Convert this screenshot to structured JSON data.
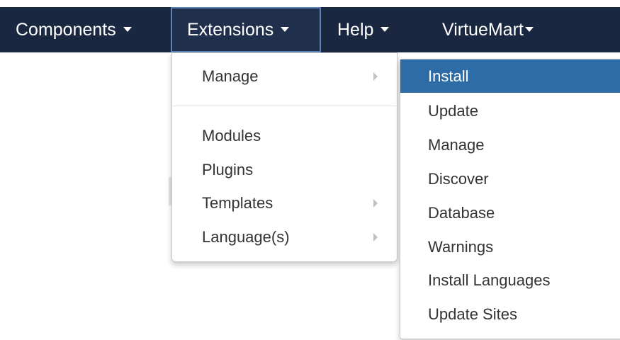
{
  "navbar": {
    "items": [
      {
        "label": "Components"
      },
      {
        "label": "Extensions"
      },
      {
        "label": "Help"
      },
      {
        "label": "VirtueMart"
      }
    ],
    "colors": {
      "background": "#1a2740",
      "active_item_background": "#1f2f4c",
      "active_item_border": "#5c82b8",
      "text": "#ffffff"
    }
  },
  "extensions_menu": {
    "items": [
      {
        "label": "Manage",
        "has_submenu": true
      },
      {
        "label": "Modules",
        "has_submenu": false
      },
      {
        "label": "Plugins",
        "has_submenu": false
      },
      {
        "label": "Templates",
        "has_submenu": true
      },
      {
        "label": "Language(s)",
        "has_submenu": true
      }
    ]
  },
  "manage_submenu": {
    "items": [
      {
        "label": "Install",
        "active": true
      },
      {
        "label": "Update"
      },
      {
        "label": "Manage"
      },
      {
        "label": "Discover"
      },
      {
        "label": "Database"
      },
      {
        "label": "Warnings"
      },
      {
        "label": "Install Languages"
      },
      {
        "label": "Update Sites"
      }
    ],
    "colors": {
      "active_background": "#2d6ca7",
      "active_text": "#ffffff",
      "text": "#333333"
    }
  },
  "icons": {
    "dropdown_caret": "caret-down-icon",
    "submenu_arrow": "caret-right-icon"
  }
}
